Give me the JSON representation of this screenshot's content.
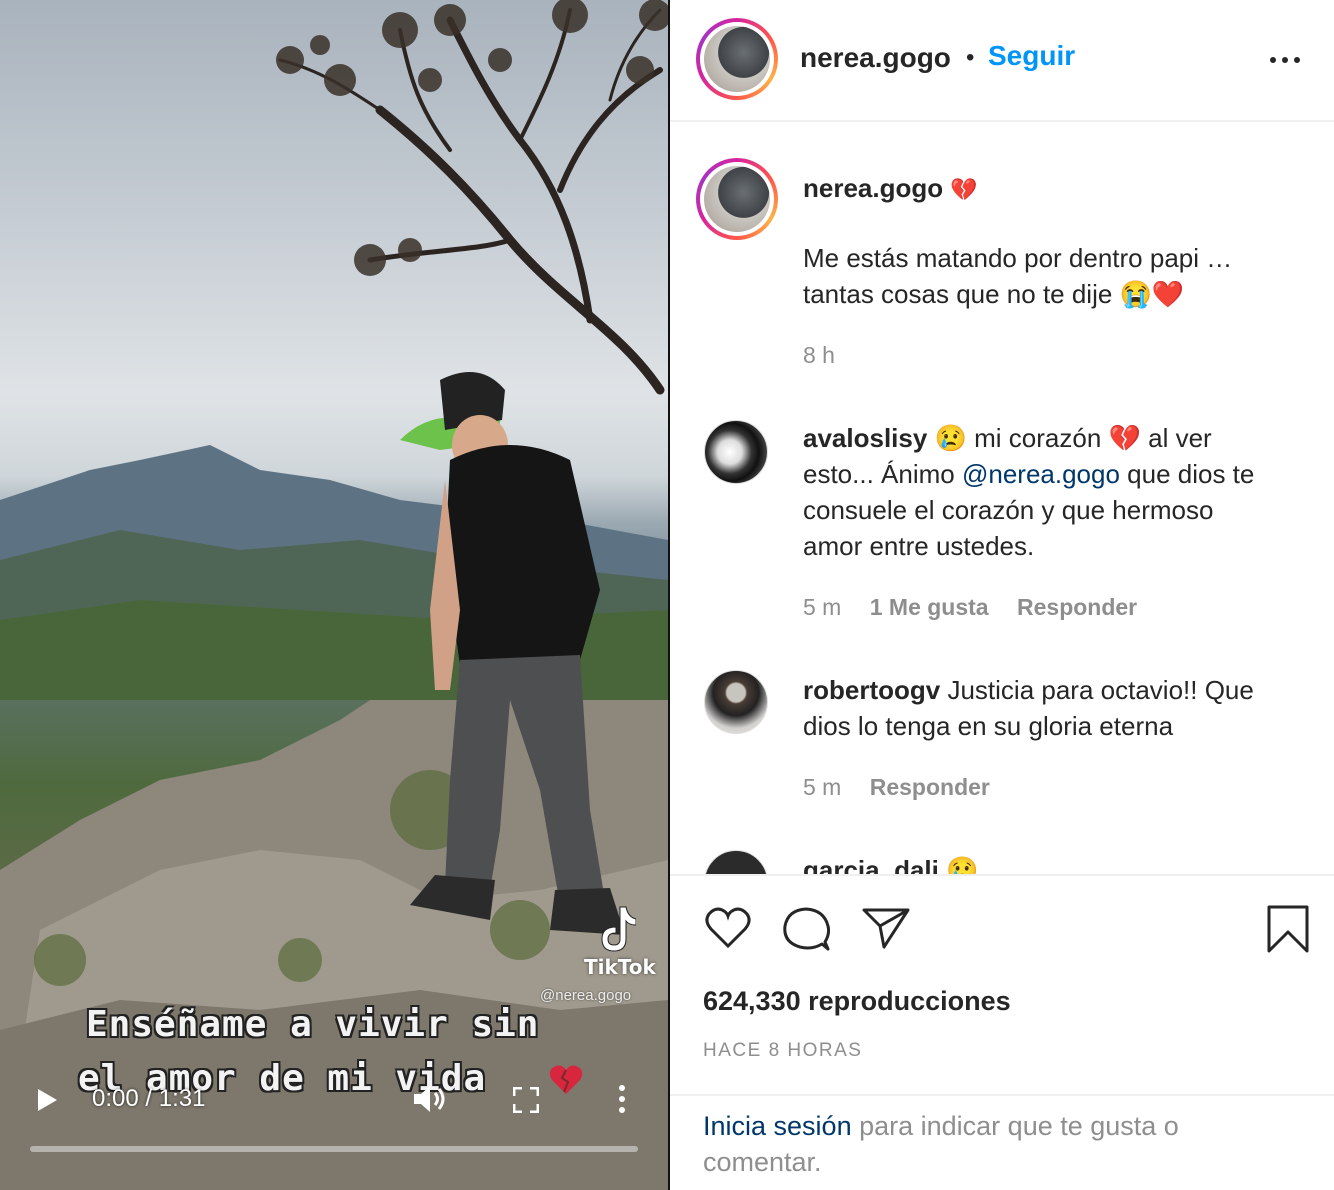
{
  "video": {
    "overlay_line1": "Enséñame a vivir sin",
    "overlay_line2": "el amor de mi vida",
    "tiktok_brand": "TikTok",
    "tiktok_handle": "@nerea.gogo",
    "time": "0:00 / 1:31",
    "progress": 0.0
  },
  "header": {
    "username": "nerea.gogo",
    "separator": "•",
    "follow_label": "Seguir"
  },
  "caption": {
    "username": "nerea.gogo",
    "username_emoji": "💔",
    "line1": "Me estás matando por dentro papi …",
    "line2": "tantas cosas que no te dije 😭❤️",
    "time": "8 h"
  },
  "comments": [
    {
      "username": "avaloslisy",
      "lines": [
        "😢 mi corazón 💔 al ver",
        "esto... Ánimo ",
        "@nerea.gogo",
        " que dios te",
        "consuele el corazón y que hermoso",
        "amor entre ustedes."
      ],
      "time": "5 m",
      "likes": "1 Me gusta",
      "reply": "Responder"
    },
    {
      "username": "robertoogv",
      "lines": [
        "Justicia para octavio!! Que",
        "dios lo tenga en su gloria eterna"
      ],
      "time": "5 m",
      "reply": "Responder"
    },
    {
      "username": "garcia_dali",
      "lines": [
        "😢"
      ]
    }
  ],
  "footer": {
    "views": "624,330 reproducciones",
    "age": "HACE 8 HORAS",
    "login_link": "Inicia sesión",
    "login_rest_1": " para indicar que te gusta o",
    "login_rest_2": "comentar."
  },
  "icons": {
    "like": "heart-icon",
    "comment": "comment-icon",
    "share": "share-icon",
    "save": "bookmark-icon",
    "more": "more-icon"
  }
}
